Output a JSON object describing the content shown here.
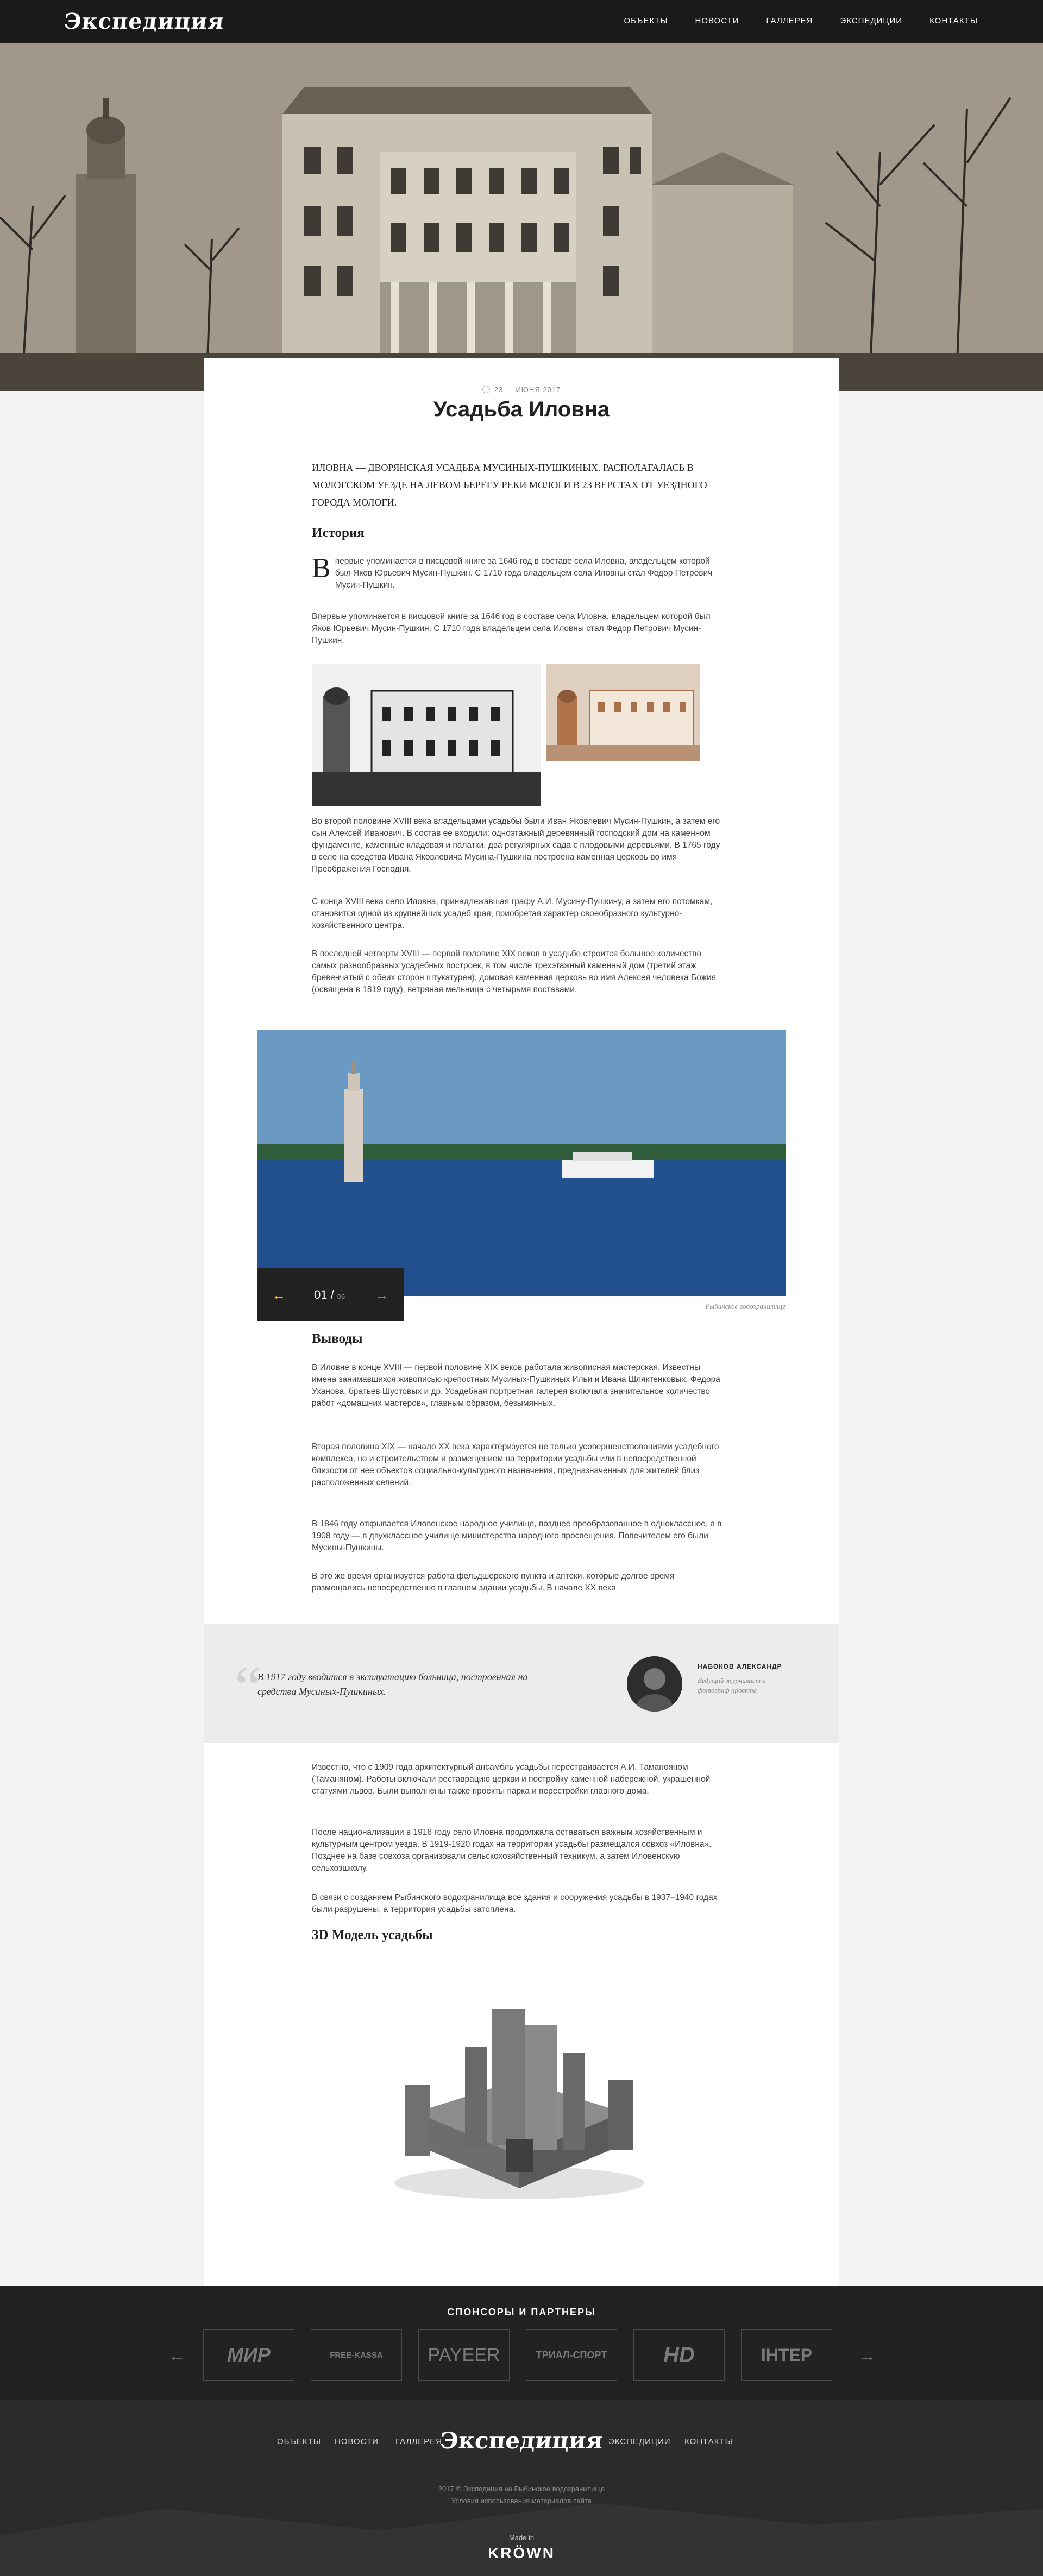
{
  "header": {
    "logo": "Экспедиция",
    "nav": [
      "ОБЪЕКТЫ",
      "НОВОСТИ",
      "ГАЛЛЕРЕЯ",
      "ЭКСПЕДИЦИИ",
      "КОНТАКТЫ"
    ]
  },
  "article": {
    "date": "23 — ИЮНЯ 2017",
    "title": "Усадьба Иловна",
    "lead": "Иловна — дворянская усадьба Мусиных-Пушкиных. Располагалась в Мологском уезде на левом берегу реки Мологи в 23 верстах от уездного города Мологи.",
    "history_heading": "История",
    "history_dropcap": "В",
    "history_p1": "первые упоминается в писцовой книге за 1646 год в составе села Иловна, владельцем которой был Яков Юрьевич Мусин-Пушкин. С 1710 года владельцем села Иловны стал Федор Петрович Мусин-Пушкин.",
    "history_p2": "Впервые упоминается в писцовой книге за 1646 год в составе села Иловна, владельцем которой был Яков Юрьевич Мусин-Пушкин. С 1710 года владельцем села Иловны стал Федор Петрович Мусин-Пушкин.",
    "history_p3": "Во второй половине XVIII века владельцами усадьбы были Иван Яковлевич Мусин-Пушкин, а затем его сын Алексей Иванович. В состав ее входили: одноэтажный деревянный господский дом на каменном фундаменте, каменные кладовая и палатки, два регулярных сада с плодовыми деревьями. В 1765 году в селе на средства Ивана Яковлевича Мусина-Пушкина построена каменная церковь во имя Преображения Господня.",
    "history_p4": "С конца XVIII века село Иловна, принадлежавшая графу А.И. Мусину-Пушкину, а затем его потомкам, становится одной из крупнейших усадеб края, приобретая характер своеобразного культурно-хозяйственного центра.",
    "history_p5": "В последней четверти XVIII — первой половине XIX веков в усадьбе строится большое количество самых разнообразных усадебных построек, в том числе трехэтажный каменный дом (третий этаж бревенчатый с обеих сторон штукатурен), домовая каменная церковь во имя Алексея человека Божия (освящена в 1819 году), ветряная мельница с четырьмя поставами.",
    "slider_current": "01 /",
    "slider_total": "06",
    "slider_caption": "Рыбинское водохранилище",
    "conclusions_heading": "Выводы",
    "conclusions_p1": "В Иловне в конце XVIII — первой половине XIX веков работала живописная мастерская. Известны имена занимавшихся живописью крепостных Мусиных-Пушкиных Ильи и Ивана Шляктенковых, Федора Уханова, братьев Шустовых и др. Усадебная портретная галерея включала значительное количество работ «домашних мастеров», главным образом, безымянных.",
    "conclusions_p2": "Вторая половина XIX — начало XX века характеризуется не только усовершенствованиями усадебного комплекса, но и строительством и размещением на территории усадьбы или в непосредственной близости от нее объектов социально-культурного назначения, предназначенных для жителей близ расположенных селений.",
    "conclusions_p3": "В 1846 году открывается Иловенское народное училище, позднее преобразованное в одноклассное, а в 1908 году — в двухклассное училище министерства народного просвещения. Попечителем его были Мусины-Пушкины.",
    "conclusions_p4": "В это же время организуется работа фельдшерского пункта и аптеки, которые долгое время размещались непосредственно в главном здании усадьбы. В начале XX века",
    "quote": "В 1917 году вводится в эксплуатацию больница, построенная на средства Мусиных-Пушкиных.",
    "quote_author": "НАБОКОВ АЛЕКСАНДР",
    "quote_author_role": "Ведущий журналист и фотограф проекта",
    "after_p1": "Известно, что с 1909 года архитектурный ансамбль усадьбы перестраивается А.И. Таманояном (Таманяном). Работы включали реставрацию церкви и постройку каменной набережной, украшенной статуями львов. Были выполнены также проекты парка и перестройки главного дома.",
    "after_p2": "После национализации в 1918 году село Иловна продолжала оставаться важным хозяйственным и культурным центром уезда. В 1919-1920 годах на территории усадьбы размещался совхоз «Иловна». Позднее на базе совхоза организовали сельскохозяйственный техникум, а затем Иловенскую сельхозшколу.",
    "after_p3": "В связи с созданием Рыбинского водохранилища все здания и сооружения усадьбы в 1937–1940 годах были разрушены, а территория усадьбы затоплена.",
    "model_heading": "3D Модель усадьбы"
  },
  "sponsors": {
    "title": "СПОНСОРЫ И ПАРТНЕРЫ",
    "logos": [
      "МИР",
      "FREE-KASSA",
      "PAYEER",
      "ТРИАЛ-СПОРТ",
      "HD",
      "ІНТЕР"
    ],
    "prev_arrow": "←",
    "next_arrow": "→"
  },
  "footer": {
    "nav_left": [
      "ОБЪЕКТЫ",
      "НОВОСТИ",
      "ГАЛЛЕРЕЯ"
    ],
    "logo": "Экспедиция",
    "nav_right": [
      "ЭКСПЕДИЦИИ",
      "КОНТАКТЫ"
    ],
    "copyright": "2017 © Экспедиция на Рыбинское водохранилище",
    "terms": "Условия использования материалов сайта",
    "made_in": "Made in",
    "studio": "KRÖWN"
  },
  "colors": {
    "accent": "#e4b32a",
    "dark": "#1a1a1a"
  }
}
